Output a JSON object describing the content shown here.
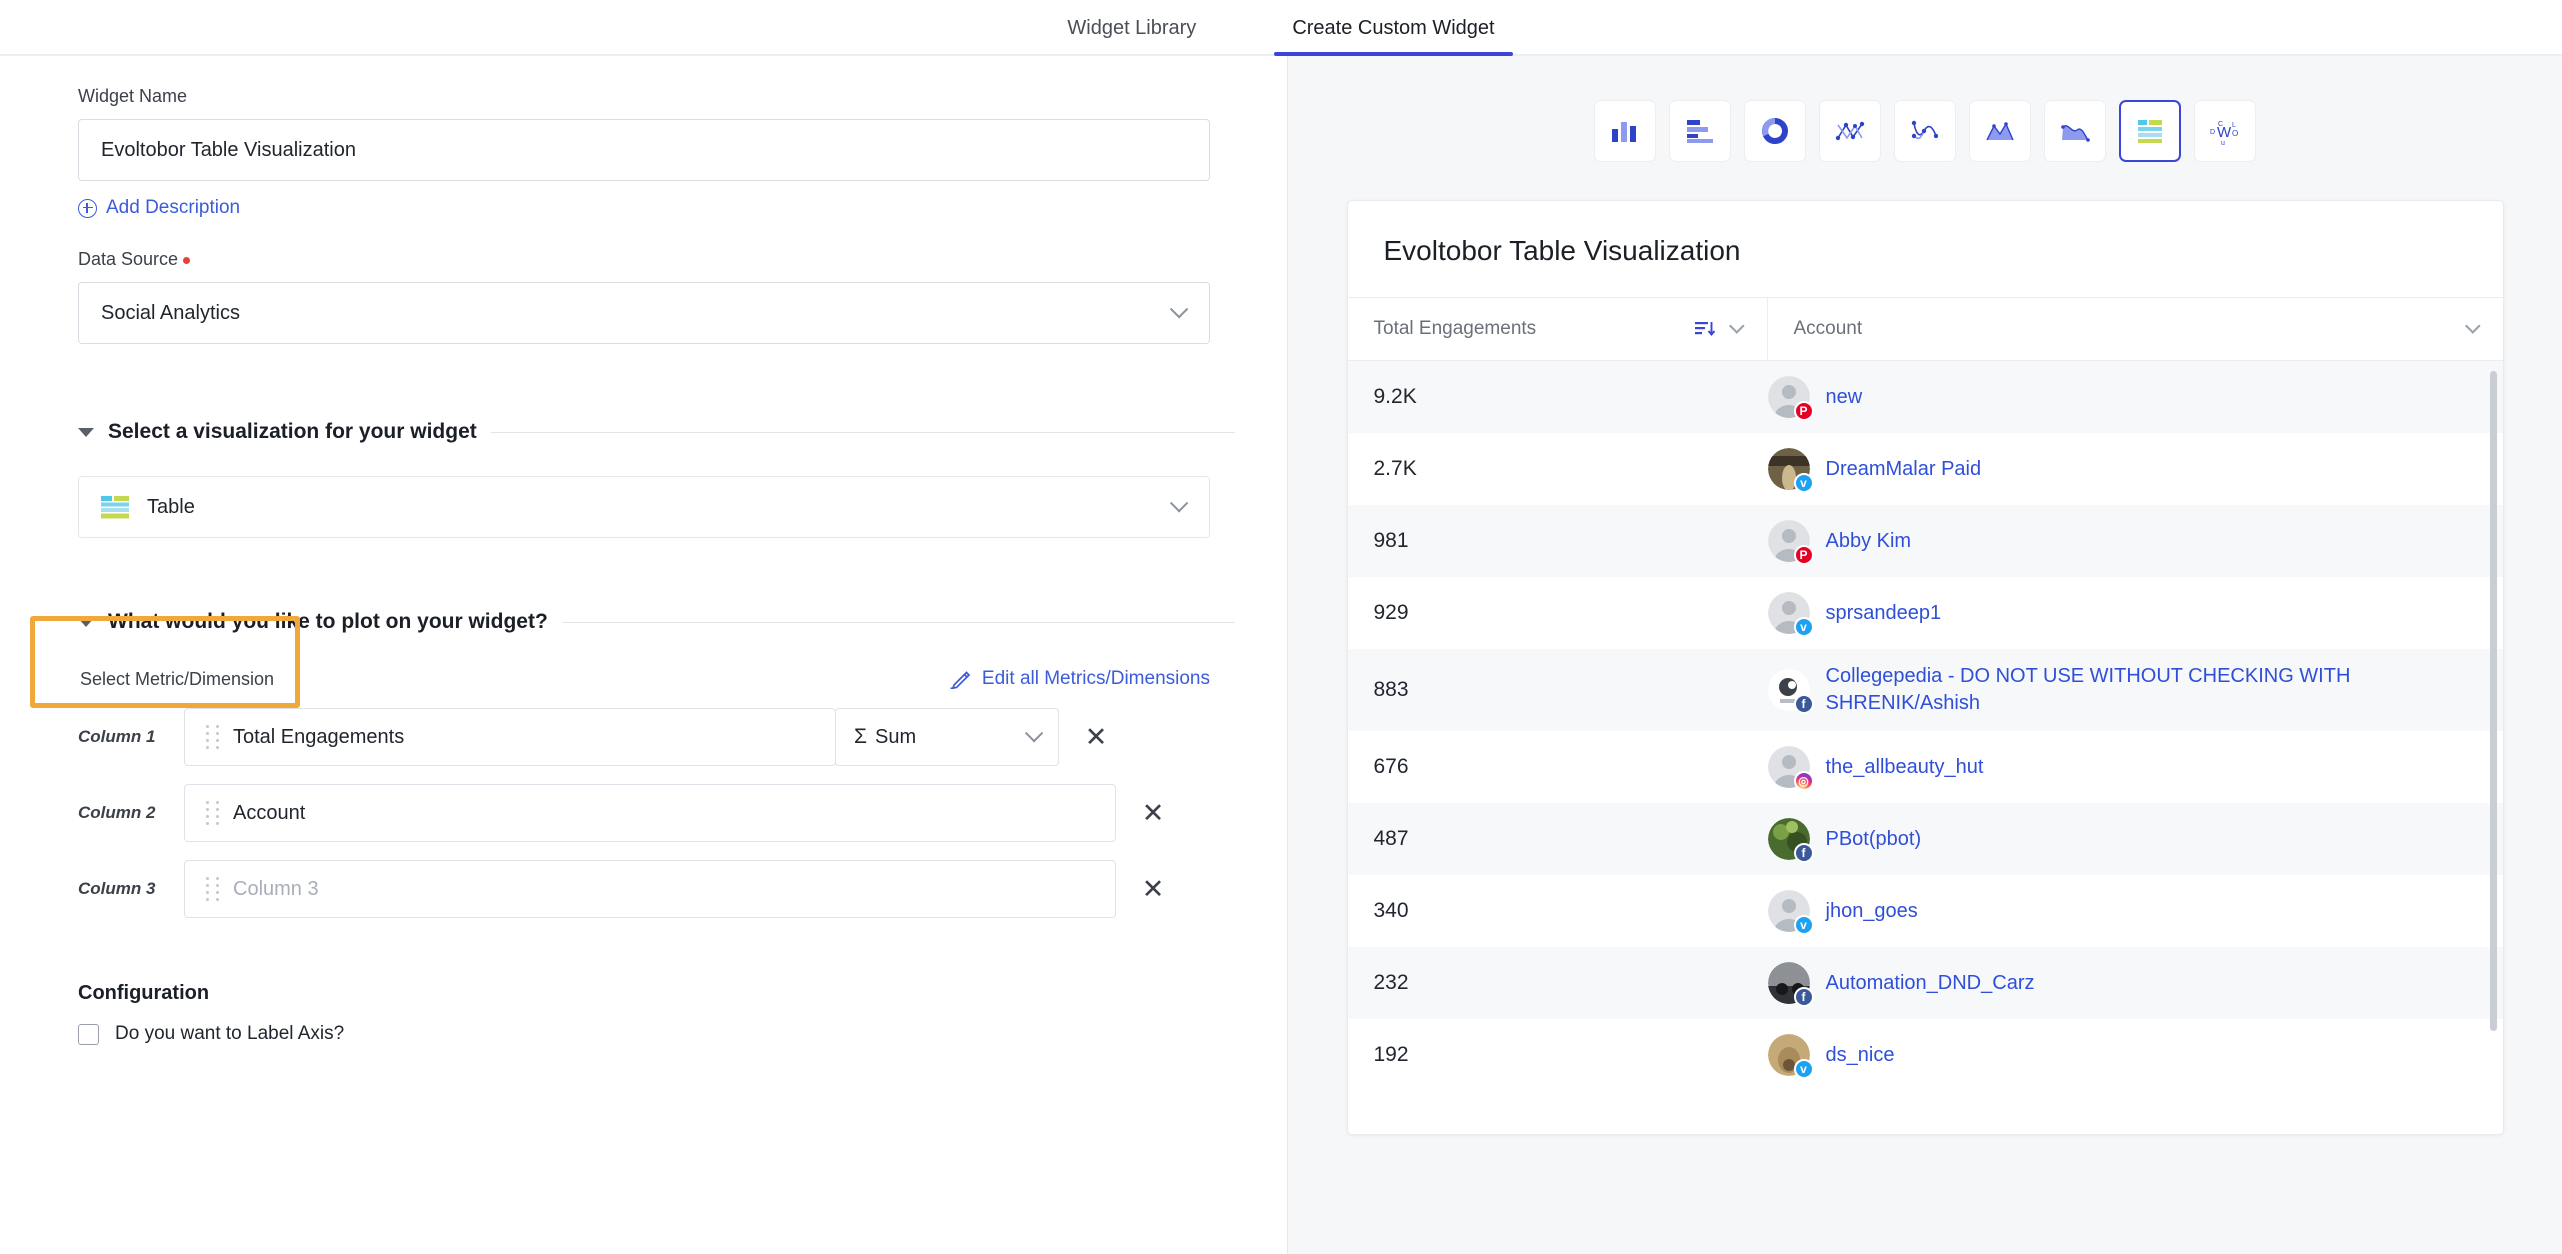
{
  "tabs": [
    {
      "label": "Widget Library",
      "active": false
    },
    {
      "label": "Create Custom Widget",
      "active": true
    }
  ],
  "form": {
    "widget_name_label": "Widget Name",
    "widget_name_value": "Evoltobor Table Visualization",
    "add_description_label": "Add Description",
    "data_source_label": "Data Source",
    "data_source_value": "Social Analytics",
    "viz_section_title": "Select a visualization for your widget",
    "viz_selected": "Table",
    "plot_section_title": "What would you like to plot on your widget?",
    "select_metric_label": "Select Metric/Dimension",
    "edit_all_label": "Edit all Metrics/Dimensions",
    "columns": [
      {
        "tag": "Column 1",
        "value": "Total Engagements",
        "placeholder": "Column 1",
        "agg": "Sum",
        "has_agg": true
      },
      {
        "tag": "Column 2",
        "value": "Account",
        "placeholder": "Column 2",
        "has_agg": false
      },
      {
        "tag": "Column 3",
        "value": "",
        "placeholder": "Column 3",
        "has_agg": false
      }
    ],
    "configuration_title": "Configuration",
    "label_axis_label": "Do you want to Label Axis?",
    "label_axis_checked": false
  },
  "chart_types": [
    {
      "name": "column-chart-icon",
      "selected": false
    },
    {
      "name": "bar-chart-icon",
      "selected": false
    },
    {
      "name": "donut-chart-icon",
      "selected": false
    },
    {
      "name": "scatter-chart-icon",
      "selected": false
    },
    {
      "name": "line-scatter-chart-icon",
      "selected": false
    },
    {
      "name": "area-chart-icon",
      "selected": false
    },
    {
      "name": "area-spline-chart-icon",
      "selected": false
    },
    {
      "name": "table-chart-icon",
      "selected": true
    },
    {
      "name": "word-cloud-icon",
      "selected": false
    }
  ],
  "preview": {
    "title": "Evoltobor Table Visualization",
    "sort_active_column": "Total Engagements",
    "sort_direction": "descending"
  },
  "chart_data": {
    "type": "table",
    "title": "Evoltobor Table Visualization",
    "columns": [
      "Total Engagements",
      "Account"
    ],
    "rows": [
      {
        "value": "9.2K",
        "account": "new",
        "network": "pinterest",
        "avatar": "placeholder"
      },
      {
        "value": "2.7K",
        "account": "DreamMalar Paid",
        "network": "twitter",
        "avatar": "photo-dark"
      },
      {
        "value": "981",
        "account": "Abby Kim",
        "network": "pinterest",
        "avatar": "placeholder"
      },
      {
        "value": "929",
        "account": "sprsandeep1",
        "network": "twitter",
        "avatar": "placeholder"
      },
      {
        "value": "883",
        "account": "Collegepedia - DO NOT USE WITHOUT CHECKING WITH SHRENIK/Ashish",
        "network": "facebook",
        "avatar": "logo-light"
      },
      {
        "value": "676",
        "account": "the_allbeauty_hut",
        "network": "instagram",
        "avatar": "placeholder"
      },
      {
        "value": "487",
        "account": "PBot(pbot)",
        "network": "facebook",
        "avatar": "photo-green"
      },
      {
        "value": "340",
        "account": "jhon_goes",
        "network": "twitter",
        "avatar": "placeholder"
      },
      {
        "value": "232",
        "account": "Automation_DND_Carz",
        "network": "facebook",
        "avatar": "photo-grey"
      },
      {
        "value": "192",
        "account": "ds_nice",
        "network": "twitter",
        "avatar": "photo-tan"
      }
    ]
  },
  "colors": {
    "accent_blue": "#3b46d8",
    "link_blue": "#2f4fd8",
    "highlight_orange": "#f0a83a",
    "required_red": "#e0433a",
    "panel_bg": "#f6f7f9"
  }
}
